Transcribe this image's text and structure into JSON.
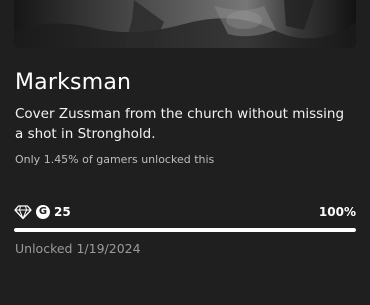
{
  "achievement": {
    "title": "Marksman",
    "description": "Cover Zussman from the church without missing a shot in Stronghold.",
    "rarity_text": "Only 1.45% of gamers unlocked this",
    "gamerscore": "25",
    "gamerscore_icon": "G",
    "progress_label": "100%",
    "progress_value": 1.0,
    "unlocked_text": "Unlocked 1/19/2024"
  },
  "icons": {
    "rarity": "diamond-icon",
    "gamerscore": "gamerscore-icon"
  },
  "colors": {
    "background": "#1f1f1f",
    "progress_fill": "#ffffff",
    "progress_track": "#444444",
    "muted_text": "#9a9a9a"
  }
}
